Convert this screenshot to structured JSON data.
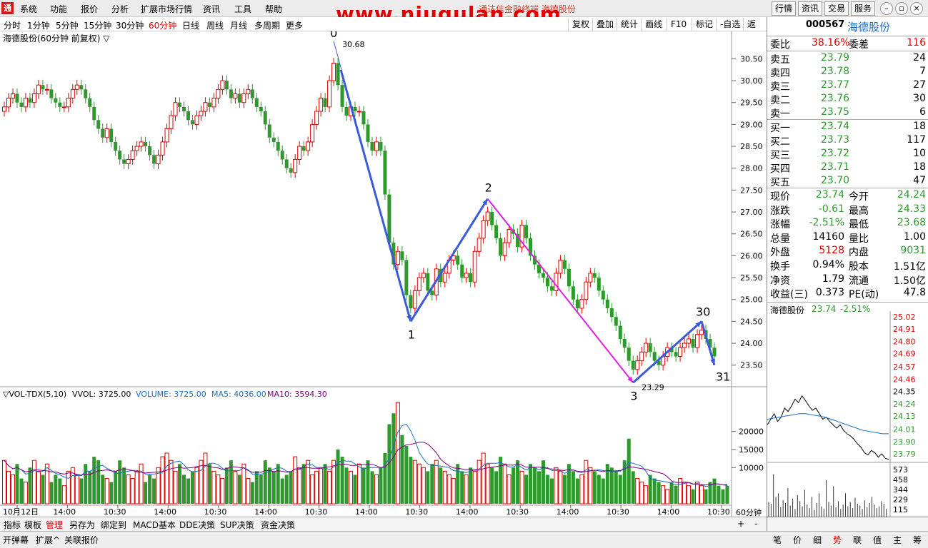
{
  "menu": {
    "logo": "通",
    "items": [
      "系统",
      "功能",
      "报价",
      "分析",
      "扩展市场行情",
      "资讯",
      "工具",
      "帮助"
    ],
    "app_title": "通达信金融终端 海德股份",
    "watermark": "www.niugulan.com",
    "right_buttons": [
      "行情",
      "资讯",
      "交易",
      "服务"
    ]
  },
  "periods": {
    "items": [
      "分时",
      "1分钟",
      "5分钟",
      "15分钟",
      "30分钟",
      "60分钟",
      "日线",
      "周线",
      "月线",
      "多周期",
      "更多"
    ],
    "active": "60分钟",
    "tools": [
      "复权",
      "叠加",
      "统计",
      "画线",
      "F10",
      "标记",
      "-自选",
      "返回"
    ]
  },
  "chart_header": "海德股份(60分钟 前复权) ▽",
  "vol_header": {
    "name": "▽VOL-TDX(5,10)",
    "vvol": "VVOL: 3725.00",
    "volume": "VOLUME: 3725.00",
    "ma5": "MA5: 4036.00",
    "ma10": "MA10: 3594.30"
  },
  "chart_data": {
    "type": "candlestick",
    "price_axis": [
      "30.50",
      "30.00",
      "29.50",
      "29.00",
      "28.50",
      "28.00",
      "27.50",
      "27.00",
      "26.50",
      "26.00",
      "25.50",
      "25.00",
      "24.50",
      "24.00",
      "23.50"
    ],
    "price_range": [
      23.3,
      30.8
    ],
    "volume_axis": [
      "20000",
      "15000",
      "10000"
    ],
    "volume_range": [
      0,
      29000
    ],
    "x_labels": [
      "10月12日",
      "14:00",
      "10:30",
      "14:00",
      "10:30",
      "14:00",
      "10:30",
      "14:00",
      "10:30",
      "14:00",
      "10:30",
      "14:00",
      "10:30",
      "14:00",
      "10:30"
    ],
    "high_label": "30.68",
    "low_label": "23.29",
    "wave_labels": [
      "0",
      "1",
      "2",
      "3",
      "30",
      "31"
    ],
    "close_series": [
      29.4,
      29.6,
      29.7,
      29.5,
      29.4,
      29.6,
      29.5,
      29.7,
      29.9,
      29.8,
      29.8,
      29.6,
      29.5,
      29.4,
      29.4,
      29.6,
      29.8,
      29.9,
      29.8,
      29.6,
      29.4,
      29.1,
      28.9,
      28.7,
      28.9,
      28.6,
      28.4,
      28.2,
      28.1,
      28.2,
      28.4,
      28.5,
      28.6,
      28.5,
      28.3,
      28.1,
      28.3,
      28.6,
      28.9,
      29.2,
      29.5,
      29.4,
      29.3,
      29.1,
      29.0,
      29.2,
      29.3,
      29.5,
      29.4,
      29.6,
      29.8,
      30.0,
      29.8,
      29.6,
      29.7,
      29.5,
      29.7,
      29.8,
      29.6,
      29.4,
      29.3,
      29.0,
      28.7,
      28.6,
      28.4,
      28.2,
      28.0,
      27.9,
      28.2,
      28.5,
      28.4,
      28.6,
      29.0,
      29.3,
      29.6,
      29.4,
      30.0,
      30.4,
      29.9,
      29.4,
      29.2,
      29.4,
      29.3,
      29.3,
      29.0,
      28.6,
      28.4,
      28.6,
      28.4,
      27.4,
      26.3,
      25.8,
      26.1,
      25.9,
      25.1,
      24.8,
      25.2,
      25.5,
      25.6,
      25.2,
      25.1,
      25.7,
      25.4,
      25.6,
      25.9,
      26.0,
      25.8,
      25.5,
      25.6,
      25.4,
      26.1,
      26.4,
      26.8,
      27.0,
      26.7,
      26.4,
      26.0,
      26.3,
      26.6,
      26.5,
      26.2,
      26.7,
      26.4,
      26.0,
      25.8,
      25.6,
      25.5,
      25.3,
      25.2,
      25.6,
      25.9,
      25.7,
      25.3,
      25.0,
      24.8,
      25.0,
      25.4,
      25.6,
      25.5,
      25.2,
      25.0,
      24.8,
      24.6,
      24.4,
      24.1,
      23.9,
      23.6,
      23.4,
      23.6,
      23.8,
      24.0,
      23.8,
      23.6,
      23.5,
      23.7,
      23.9,
      23.8,
      23.7,
      23.9,
      24.0,
      24.1,
      23.9,
      24.2,
      24.3,
      24.1,
      23.9,
      23.7
    ],
    "volume_series": [
      12,
      9,
      8,
      11,
      7,
      6,
      10,
      12,
      9,
      8,
      11,
      6,
      8,
      7,
      5,
      9,
      10,
      8,
      7,
      11,
      9,
      13,
      12,
      8,
      7,
      6,
      9,
      12,
      10,
      8,
      7,
      9,
      11,
      6,
      8,
      7,
      10,
      13,
      14,
      12,
      9,
      11,
      8,
      7,
      9,
      10,
      12,
      14,
      11,
      9,
      8,
      7,
      10,
      12,
      9,
      8,
      11,
      7,
      6,
      9,
      8,
      12,
      10,
      9,
      11,
      7,
      8,
      9,
      13,
      10,
      11,
      12,
      8,
      9,
      10,
      11,
      9,
      12,
      15,
      13,
      10,
      9,
      8,
      11,
      10,
      12,
      9,
      8,
      10,
      14,
      22,
      25,
      28,
      19,
      16,
      13,
      12,
      11,
      10,
      9,
      11,
      12,
      10,
      9,
      8,
      7,
      11,
      9,
      8,
      10,
      9,
      12,
      14,
      11,
      10,
      9,
      13,
      11,
      8,
      10,
      12,
      9,
      8,
      11,
      10,
      9,
      12,
      8,
      7,
      10,
      9,
      8,
      11,
      9,
      7,
      8,
      12,
      10,
      9,
      8,
      7,
      11,
      10,
      9,
      8,
      12,
      18,
      9,
      7,
      6,
      5,
      8,
      7,
      6,
      5,
      4,
      6,
      5,
      7,
      6,
      5,
      4,
      6,
      5,
      4,
      6,
      7,
      5,
      4,
      5
    ]
  },
  "quote": {
    "code": "000567",
    "name": "海德股份",
    "weibi_label": "委比",
    "weibi": "38.16%",
    "weicha_label": "委差",
    "weicha": "116",
    "asks": [
      {
        "label": "卖五",
        "price": "23.79",
        "vol": "24"
      },
      {
        "label": "卖四",
        "price": "23.78",
        "vol": "7"
      },
      {
        "label": "卖三",
        "price": "23.77",
        "vol": "27"
      },
      {
        "label": "卖二",
        "price": "23.76",
        "vol": "30"
      },
      {
        "label": "卖一",
        "price": "23.75",
        "vol": "6"
      }
    ],
    "bids": [
      {
        "label": "买一",
        "price": "23.74",
        "vol": "18"
      },
      {
        "label": "买二",
        "price": "23.73",
        "vol": "117"
      },
      {
        "label": "买三",
        "price": "23.72",
        "vol": "10"
      },
      {
        "label": "买四",
        "price": "23.71",
        "vol": "18"
      },
      {
        "label": "买五",
        "price": "23.70",
        "vol": "47"
      }
    ],
    "stats": [
      {
        "l1": "现价",
        "v1": "23.74",
        "l2": "今开",
        "v2": "24.24"
      },
      {
        "l1": "涨跌",
        "v1": "-0.61",
        "l2": "最高",
        "v2": "24.33"
      },
      {
        "l1": "涨幅",
        "v1": "-2.51%",
        "l2": "最低",
        "v2": "23.68"
      },
      {
        "l1": "总量",
        "v1": "14160",
        "l2": "量比",
        "v2": "1.00"
      },
      {
        "l1": "外盘",
        "v1": "5128",
        "l2": "内盘",
        "v2": "9031"
      },
      {
        "l1": "换手",
        "v1": "0.94%",
        "l2": "股本",
        "v2": "1.51亿"
      },
      {
        "l1": "净资",
        "v1": "1.79",
        "l2": "流通",
        "v2": "1.50亿"
      },
      {
        "l1": "收益(三)",
        "v1": "0.373",
        "l2": "PE(动)",
        "v2": "47.8"
      }
    ],
    "mini_title": "海德股份",
    "mini_price": "23.74",
    "mini_change": "-2.51%",
    "mini_axis": [
      "25.02",
      "24.91",
      "24.80",
      "24.69",
      "24.57",
      "24.46",
      "24.35",
      "24.24",
      "24.13",
      "24.01",
      "23.90",
      "23.79"
    ],
    "mini_vol_axis": [
      "573",
      "458",
      "344",
      "229",
      "115"
    ]
  },
  "bottom_tabs": [
    "指标",
    "模板",
    "管理",
    "另存为",
    "绑定到",
    "MACD基本",
    "DDE决策",
    "SUP决策",
    "资金决策"
  ],
  "period_select": "60分钟",
  "status_tabs": [
    "开弹幕",
    "扩展^",
    "关联报价"
  ],
  "right_tabs": [
    "笔",
    "价",
    "细",
    "势",
    "联",
    "值",
    "主",
    "筹"
  ],
  "colors": {
    "up": "#e00000",
    "down": "#2e9a2e",
    "wave": "#3a5bd9",
    "magenta": "#e020e0",
    "purple": "#800080"
  }
}
